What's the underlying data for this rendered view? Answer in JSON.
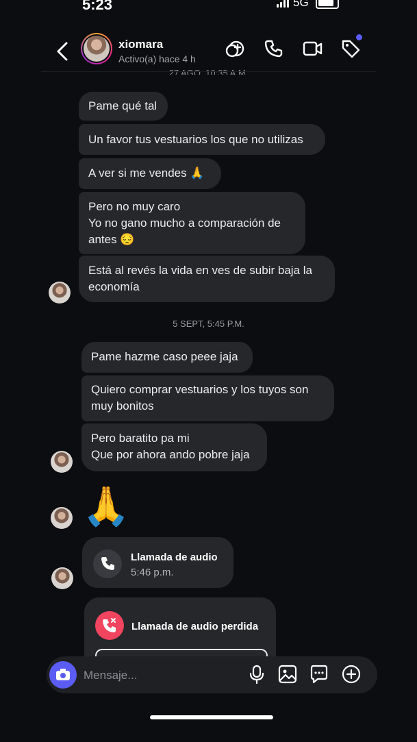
{
  "status_bar": {
    "time": "5:23",
    "network": "5G"
  },
  "header": {
    "name": "xiomara",
    "status": "Activo(a) hace 4 h",
    "partial_date": "27 AGO, 10:35 A.M."
  },
  "messages_group1": [
    {
      "text": "Pame qué tal"
    },
    {
      "text": "Un favor tus vestuarios los que no utilizas"
    },
    {
      "text": "A ver si me vendes 🙏"
    },
    {
      "text": "Pero no muy caro\nYo no gano mucho a comparación de\nantes 😔"
    },
    {
      "text": "Está al revés la vida en ves de subir baja la\neconomía"
    }
  ],
  "date_sep2": "5 SEPT, 5:45 P.M.",
  "messages_group2": [
    {
      "text": "Pame hazme caso peee jaja"
    },
    {
      "text": "Quiero comprar vestuarios y los tuyos son\nmuy bonitos"
    },
    {
      "text": "Pero baratito pa mi\nQue por ahora ando pobre jaja"
    }
  ],
  "big_emoji": "🙏",
  "audio_call": {
    "title": "Llamada de audio",
    "time": "5:46 p.m."
  },
  "missed_call": {
    "title": "Llamada de audio perdida"
  },
  "composer": {
    "placeholder": "Mensaje..."
  },
  "colors": {
    "background": "#0c0d10",
    "bubble": "#26272b",
    "accent": "#5a5cf3",
    "missed": "#f0445f"
  }
}
